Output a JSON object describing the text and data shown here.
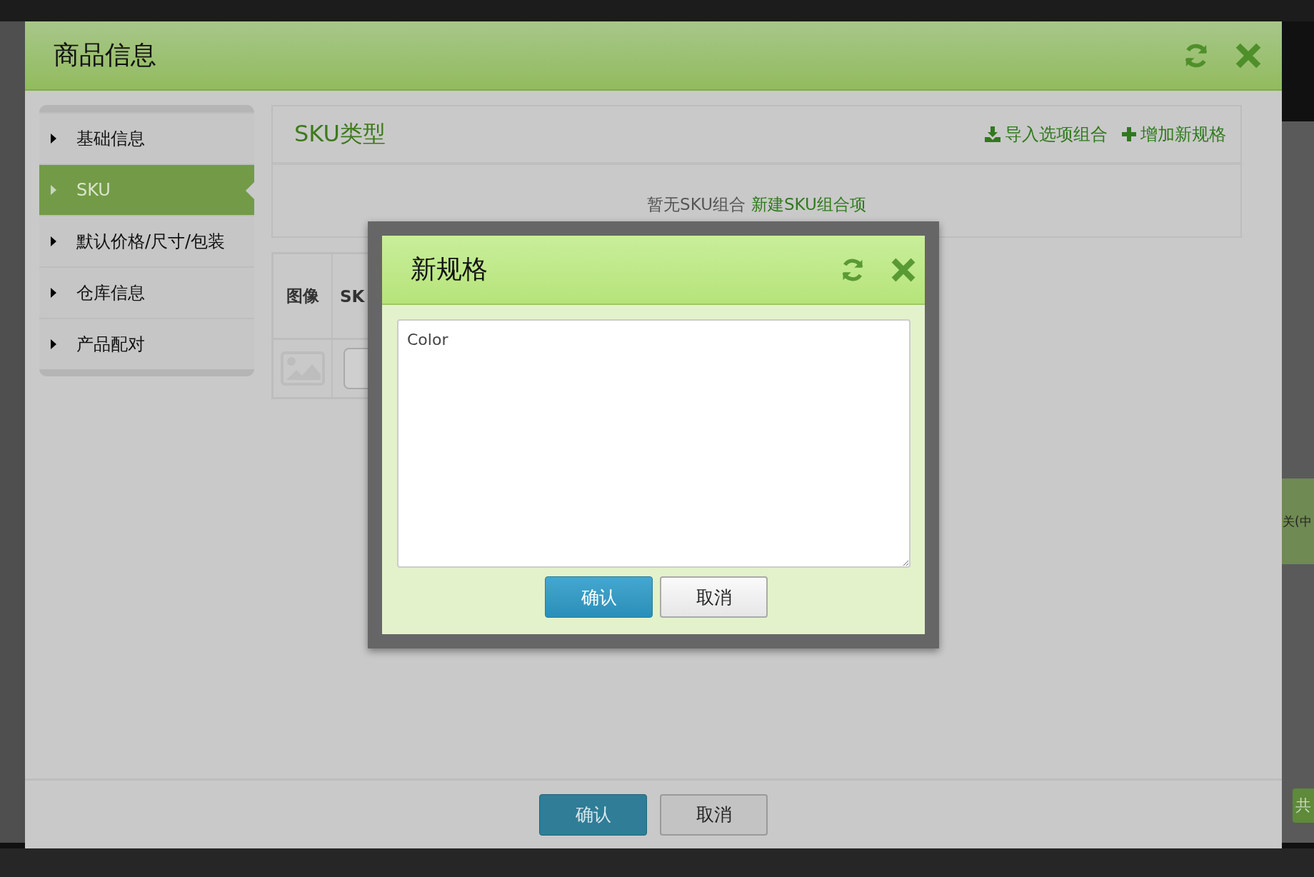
{
  "background": {
    "side_label": "关(中",
    "side_button": "共"
  },
  "window": {
    "title": "商品信息"
  },
  "sidebar": {
    "items": [
      {
        "label": "基础信息",
        "selected": false
      },
      {
        "label": "SKU",
        "selected": true
      },
      {
        "label": "默认价格/尺寸/包装",
        "selected": false
      },
      {
        "label": "仓库信息",
        "selected": false
      },
      {
        "label": "产品配对",
        "selected": false
      }
    ]
  },
  "panel": {
    "title": "SKU类型",
    "actions": [
      {
        "kind": "import",
        "label": "导入选项组合"
      },
      {
        "kind": "add",
        "label": "增加新规格"
      }
    ],
    "empty_text": "暂无SKU组合",
    "empty_link": "新建SKU组合项"
  },
  "table": {
    "columns": [
      "图像",
      "SK"
    ]
  },
  "dialog": {
    "title": "新规格",
    "value": "Color",
    "buttons": [
      {
        "kind": "primary",
        "label": "确认"
      },
      {
        "kind": "default",
        "label": "取消"
      }
    ]
  },
  "footer": {
    "buttons": [
      {
        "kind": "primary",
        "label": "确认"
      },
      {
        "kind": "default",
        "label": "取消"
      }
    ]
  }
}
